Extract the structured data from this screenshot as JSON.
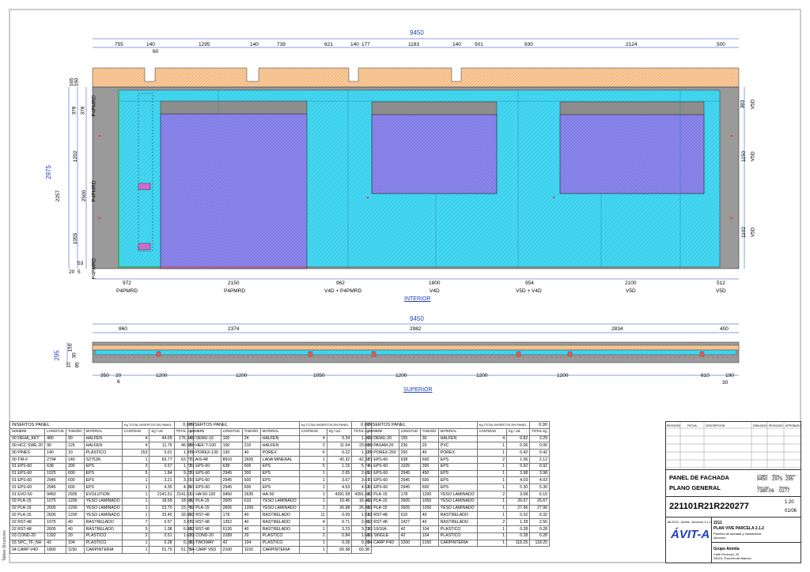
{
  "elevation": {
    "total_width": "9450",
    "top_dims": [
      "755",
      "140",
      "60",
      "1295",
      "140",
      "739",
      "621",
      "140",
      "177",
      "1183",
      "140",
      "501",
      "930",
      "2124",
      "500"
    ],
    "left_dims": [
      "378",
      "165",
      "190",
      "378",
      "2975",
      "1202",
      "2257",
      "2500",
      "1055",
      "20",
      "5",
      "53"
    ],
    "left_codes": [
      "P4PMRD",
      "P4PMRD",
      "P4PMRD"
    ],
    "right_dims": [
      "383",
      "1150",
      "1102"
    ],
    "right_codes": [
      "V5D",
      "V5D",
      "V5D"
    ],
    "bottom_dims": [
      "972",
      "2150",
      "962",
      "1800",
      "954",
      "2100",
      "512"
    ],
    "bottom_codes": [
      "P4PMRD",
      "P4PMRD",
      "V4D + P4PMRD",
      "V4D",
      "V5D + V4D",
      "V5D",
      "V5D"
    ],
    "view_label": "INTERIOR"
  },
  "plan": {
    "total_width": "9450",
    "top_dims": [
      "860",
      "2374",
      "2982",
      "2834",
      "400"
    ],
    "left_dims": [
      "295",
      "150",
      "30",
      "15",
      "95"
    ],
    "bottom_dims": [
      "350",
      "20",
      "1200",
      "1200",
      "1050",
      "1200",
      "1200",
      "1200",
      "610",
      "190",
      "30"
    ],
    "extra_dims": [
      "6",
      "30"
    ],
    "view_label": "SUPERIOR"
  },
  "tables": [
    {
      "title": "INSERTOS PANEL",
      "total_label": "Kg TOTAL INSERTOS EN PANEL",
      "total_value": "0.00",
      "headers": [
        "NOMBRE",
        "LONGITUD",
        "TAMAÑO",
        "MATERIAL",
        "CANTIDAD",
        "Kg / Ud.",
        "TOTAL Kg"
      ],
      "rows": [
        [
          "00 DEHA_KKT",
          "480",
          "90",
          "HALFEN",
          "4",
          "44.09",
          "176.34"
        ],
        [
          "00 HCC SWE 20",
          "90",
          "125",
          "HALFEN",
          "4",
          "11.75",
          "46.98"
        ],
        [
          "00 PINES",
          "140",
          "10",
          "PLASTICO",
          "153",
          "0.01",
          "1.97"
        ],
        [
          "00 TIR-F",
          "2794",
          "140",
          "S275JR",
          "1",
          "63.77",
          "63.77"
        ],
        [
          "01 EPS-60",
          "638",
          "300",
          "EPS",
          "3",
          "0.57",
          "1.72"
        ],
        [
          "01 EPS-60",
          "1025",
          "600",
          "EPS",
          "5",
          "1.84",
          "9.22"
        ],
        [
          "01 EPS-60",
          "2945",
          "600",
          "EPS",
          "1",
          "3.21",
          "3.21"
        ],
        [
          "01 EPS-60",
          "2945",
          "600",
          "EPS",
          "1",
          "4.35",
          "4.35"
        ],
        [
          "01 EVO-50",
          "9450",
          "2935",
          "EVOLUTION",
          "1",
          "2141.51",
          "2141.51"
        ],
        [
          "02 PLA-15",
          "1075",
          "1200",
          "YESO LAMINADO",
          "1",
          "18.58",
          "18.58"
        ],
        [
          "02 PLA-15",
          "2605",
          "1200",
          "YESO LAMINADO",
          "1",
          "23.70",
          "23.70"
        ],
        [
          "02 PLA-15",
          "2605",
          "1200",
          "YESO LAMINADO",
          "1",
          "33.45",
          "33.45"
        ],
        [
          "02 RST-48",
          "1075",
          "40",
          "RASTRELADO",
          "7",
          "0.57",
          "3.97"
        ],
        [
          "02 RST-48",
          "2605",
          "40",
          "RASTRELADO",
          "5",
          "1.38",
          "6.88"
        ],
        [
          "03 COND-20",
          "1392",
          "20",
          "PLASTICO",
          "2",
          "0.51",
          "1.02"
        ],
        [
          "03 SPC_TF_NH",
          "42",
          "104",
          "PLASTICO",
          "1",
          "0.28",
          "0.28"
        ],
        [
          "04 CARP V4D",
          "1800",
          "1150",
          "CARPINTERIA",
          "1",
          "51.75",
          "51.75"
        ]
      ]
    },
    {
      "title": "INSERTOS PANEL",
      "total_label": "Kg TOTAL INSERTOS EN PANEL",
      "total_value": "0.00",
      "headers": [
        "NOMBRE",
        "LONGITUD",
        "TAMAÑO",
        "MATERIAL",
        "CANTIDAD",
        "Kg / Ud.",
        "TOTAL Kg"
      ],
      "rows": [
        [
          "00 DEMU-16",
          "100",
          "24",
          "HALFEN",
          "4",
          "0.34",
          "1.36"
        ],
        [
          "00 HEK-T-100",
          "100",
          "210",
          "HALFEN",
          "2",
          "11.54",
          "23.08"
        ],
        [
          "00 POREX-130",
          "130",
          "40",
          "POREX",
          "6",
          "0.22",
          "1.32"
        ],
        [
          "01 AIS-48",
          "8910",
          "2605",
          "LANA MINERAL",
          "1",
          "42.32",
          "42.32"
        ],
        [
          "01 EPS-60",
          "638",
          "600",
          "EPS",
          "5",
          "1.15",
          "5.74"
        ],
        [
          "01 EPS-60",
          "2945",
          "300",
          "EPS",
          "1",
          "2.65",
          "2.65"
        ],
        [
          "01 EPS-60",
          "2945",
          "600",
          "EPS",
          "1",
          "3.67",
          "3.67"
        ],
        [
          "01 EPS-60",
          "2945",
          "600",
          "EPS",
          "1",
          "4.53",
          "4.53"
        ],
        [
          "01 HA-50-120",
          "9450",
          "2635",
          "HA-50",
          "1",
          "4391.58",
          "4391.58"
        ],
        [
          "02 PLA-15",
          "2605",
          "610",
          "YESO LAMINADO",
          "1",
          "16.46",
          "16.46"
        ],
        [
          "02 PLA-15",
          "2605",
          "1200",
          "YESO LAMINADO",
          "1",
          "26.98",
          "26.98"
        ],
        [
          "02 RST-48",
          "178",
          "40",
          "RASTRELADO",
          "11",
          "0.09",
          "1.03"
        ],
        [
          "02 RST-48",
          "1352",
          "40",
          "RASTRELADO",
          "4",
          "0.71",
          "2.86"
        ],
        [
          "02 RST-48",
          "6126",
          "40",
          "RASTRELADO",
          "1",
          "3.23",
          "3.23"
        ],
        [
          "03 COND-20",
          "2289",
          "20",
          "PLASTICO",
          "2",
          "0.84",
          "1.68"
        ],
        [
          "03 TWOWAY",
          "42",
          "104",
          "PLASTICO",
          "1",
          "0.28",
          "0.28"
        ],
        [
          "04 CARP V5D",
          "2100",
          "1150",
          "CARPINTERIA",
          "1",
          "60.38",
          "60.38"
        ]
      ]
    },
    {
      "title": "INSERTOS PANEL",
      "total_label": "Kg TOTAL INSERTOS EN PANEL",
      "total_value": "0.00",
      "headers": [
        "NOMBRE",
        "LONGITUD",
        "TAMAÑO",
        "MATERIAL",
        "CANTIDAD",
        "Kg / Ud.",
        "TOTAL Kg"
      ],
      "rows": [
        [
          "00 DEMU-20",
          "155",
          "30",
          "HALFEN",
          "4",
          "0.82",
          "3.29"
        ],
        [
          "00 PASAM-20",
          "236",
          "20",
          "PVC",
          "1",
          "0.06",
          "0.06"
        ],
        [
          "00 POREX-250",
          "250",
          "40",
          "POREX",
          "1",
          "0.42",
          "0.42"
        ],
        [
          "01 EPS-60",
          "638",
          "600",
          "EPS",
          "2",
          "1.06",
          "2.12"
        ],
        [
          "01 EPS-60",
          "1025",
          "300",
          "EPS",
          "1",
          "0.92",
          "0.92"
        ],
        [
          "01 EPS-60",
          "2945",
          "450",
          "EPS",
          "1",
          "3.98",
          "3.98"
        ],
        [
          "01 EPS-60",
          "2945",
          "600",
          "EPS",
          "1",
          "4.03",
          "4.03"
        ],
        [
          "01 EPS-60",
          "2945",
          "600",
          "EPS",
          "1",
          "5.30",
          "5.30"
        ],
        [
          "02 PLA-15",
          "178",
          "1200",
          "YESO LAMINADO",
          "2",
          "3.08",
          "6.15"
        ],
        [
          "02 PLA-15",
          "2605",
          "1050",
          "YESO LAMINADO",
          "1",
          "26.67",
          "26.67"
        ],
        [
          "02 PLA-15",
          "2605",
          "1200",
          "YESO LAMINADO",
          "1",
          "27.96",
          "27.96"
        ],
        [
          "02 RST-48",
          "610",
          "40",
          "RASTRELADO",
          "1",
          "0.32",
          "0.32"
        ],
        [
          "02 RST-48",
          "2427",
          "40",
          "RASTRELADO",
          "2",
          "1.28",
          "2.56"
        ],
        [
          "03 10/16A",
          "42",
          "104",
          "PLASTICO",
          "1",
          "0.28",
          "0.28"
        ],
        [
          "03 SINGLE",
          "42",
          "104",
          "PLASTICO",
          "1",
          "0.28",
          "0.28"
        ],
        [
          "04 CARP P4D",
          "2200",
          "2150",
          "CARPINTERIA",
          "1",
          "118.25",
          "118.25"
        ]
      ]
    }
  ],
  "title_block": {
    "revision_headers": [
      "REVISIÓN",
      "FECHA",
      "DESCRIPCIÓN",
      "DIBUJADO",
      "REVISADO",
      "APROBADO"
    ],
    "sheet_title_1": "PANEL DE FACHADA",
    "sheet_title_2": "PLANO GENERAL",
    "dim_labels": [
      "Longitud",
      "Altura",
      "Espesor"
    ],
    "dims": [
      "9450",
      "2975",
      "295"
    ],
    "weight_label": "Peso (kg)",
    "weight": "7380.06",
    "number_label": "Número",
    "number": "0277",
    "code": "221101R21R220277",
    "scale": "1:20",
    "sheet": "01/06",
    "file_ref": "86.2202 - Avinfa - Alcorcon 2.1.2",
    "logo": "ÁVIT-A",
    "project_no": "2211",
    "project_name": "PLAN VIVE PARCELA 2.1.2",
    "project_desc": "Paneles de fachada y medianeras",
    "project_city": "Alcorcón",
    "company": "Grupo Avintia",
    "address_1": "Calle Ermoura, 20",
    "address_2": "28224, Pozuelo de Alarcón"
  },
  "side_note": "Tablas Structures",
  "colors": {
    "panel": "#43d6f0",
    "window": "#8a86ec",
    "top_band": "#f8c99a",
    "concrete": "#9a9a9a",
    "dim_line": "#1f3fb8"
  }
}
